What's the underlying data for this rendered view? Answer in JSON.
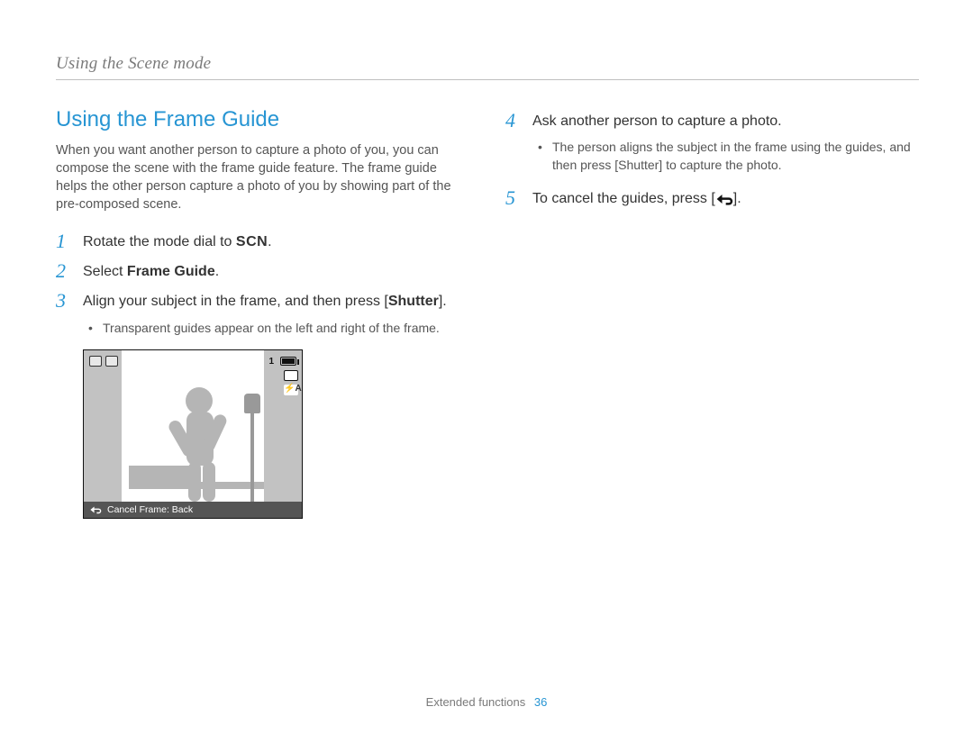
{
  "header": {
    "breadcrumb": "Using the Scene mode"
  },
  "section": {
    "title": "Using the Frame Guide"
  },
  "intro": "When you want another person to capture a photo of you, you can compose the scene with the frame guide feature. The frame guide helps the other person capture a photo of you by showing part of the pre-composed scene.",
  "steps": {
    "s1": {
      "num": "1",
      "prefix": "Rotate the mode dial to ",
      "scn": "SCN",
      "suffix": "."
    },
    "s2": {
      "num": "2",
      "prefix": "Select ",
      "bold": "Frame Guide",
      "suffix": "."
    },
    "s3": {
      "num": "3",
      "prefix": "Align your subject in the frame, and then press [",
      "bold": "Shutter",
      "suffix": "]."
    },
    "s3_sub": "Transparent guides appear on the left and right of the frame.",
    "s4": {
      "num": "4",
      "text": "Ask another person to capture a photo."
    },
    "s4_sub_prefix": "The person aligns the subject in the frame using the guides, and then press [",
    "s4_sub_bold": "Shutter",
    "s4_sub_suffix": "] to capture the photo.",
    "s5": {
      "num": "5",
      "prefix": "To cancel the guides, press [",
      "suffix": "]."
    }
  },
  "screen": {
    "caption": "Cancel Frame: Back",
    "counter": "1",
    "flash_label": "A"
  },
  "footer": {
    "section": "Extended functions",
    "page": "36"
  }
}
